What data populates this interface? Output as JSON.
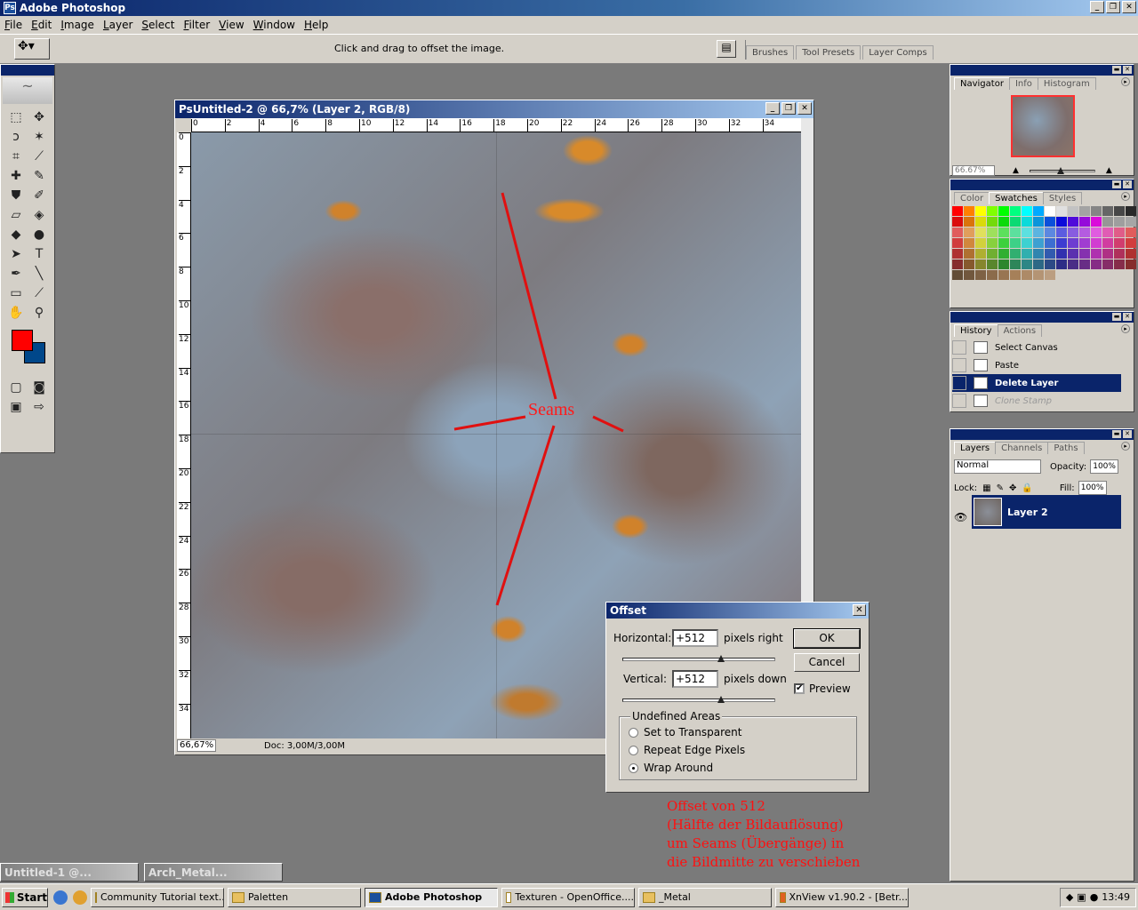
{
  "app": {
    "title": "Adobe Photoshop",
    "window_buttons": [
      "_",
      "❐",
      "✕"
    ]
  },
  "menu": [
    "File",
    "Edit",
    "Image",
    "Layer",
    "Select",
    "Filter",
    "View",
    "Window",
    "Help"
  ],
  "options_bar": {
    "hint": "Click and drag to offset the image.",
    "well_tabs": [
      "Brushes",
      "Tool Presets",
      "Layer Comps"
    ]
  },
  "document": {
    "title": "Untitled-2 @ 66,7% (Layer 2, RGB/8)",
    "zoom": "66,67%",
    "doc_size": "Doc: 3,00M/3,00M",
    "ruler_h": [
      "0",
      "2",
      "4",
      "6",
      "8",
      "10",
      "12",
      "14",
      "16",
      "18",
      "20",
      "22",
      "24",
      "26",
      "28",
      "30",
      "32",
      "34"
    ],
    "ruler_v": [
      "0",
      "2",
      "4",
      "6",
      "8",
      "10",
      "12",
      "14",
      "16",
      "18",
      "20",
      "22",
      "24",
      "26",
      "28",
      "30",
      "32",
      "34"
    ]
  },
  "annotation": {
    "seams_label": "Seams",
    "note_lines": [
      "Offset von 512",
      "(Hälfte der Bildauflösung)",
      "um Seams (Übergänge) in",
      "die Bildmitte zu verschieben"
    ],
    "color": "#ff1010"
  },
  "offset_dialog": {
    "title": "Offset",
    "horizontal_label": "Horizontal:",
    "horizontal_value": "+512",
    "horizontal_unit": "pixels right",
    "vertical_label": "Vertical:",
    "vertical_value": "+512",
    "vertical_unit": "pixels down",
    "ok": "OK",
    "cancel": "Cancel",
    "preview_label": "Preview",
    "preview_checked": true,
    "group_title": "Undefined Areas",
    "options": [
      "Set to Transparent",
      "Repeat Edge Pixels",
      "Wrap Around"
    ],
    "selected_option": "Wrap Around"
  },
  "navigator": {
    "tabs": [
      "Navigator",
      "Info",
      "Histogram"
    ],
    "zoom": "66.67%"
  },
  "swatches": {
    "tabs": [
      "Color",
      "Swatches",
      "Styles"
    ]
  },
  "history": {
    "tabs": [
      "History",
      "Actions"
    ],
    "items": [
      "Select Canvas",
      "Paste",
      "Delete Layer",
      "Clone Stamp"
    ],
    "selected": "Delete Layer"
  },
  "layers": {
    "tabs": [
      "Layers",
      "Channels",
      "Paths"
    ],
    "blend_mode": "Normal",
    "opacity_label": "Opacity:",
    "opacity": "100%",
    "lock_label": "Lock:",
    "fill_label": "Fill:",
    "fill": "100%",
    "layer_name": "Layer 2"
  },
  "minimized_docs": [
    "Untitled-1 @...",
    "Arch_Metal..."
  ],
  "taskbar": {
    "start": "Start",
    "tasks": [
      "Community Tutorial text...",
      "Paletten",
      "Adobe Photoshop",
      "Texturen - OpenOffice....",
      "_Metal",
      "XnView v1.90.2  - [Betr..."
    ],
    "active_task": "Adobe Photoshop",
    "clock": "13:49"
  },
  "colors": {
    "foreground": "#ff0000",
    "background": "#00478a",
    "title_bar": "#0a246a"
  }
}
